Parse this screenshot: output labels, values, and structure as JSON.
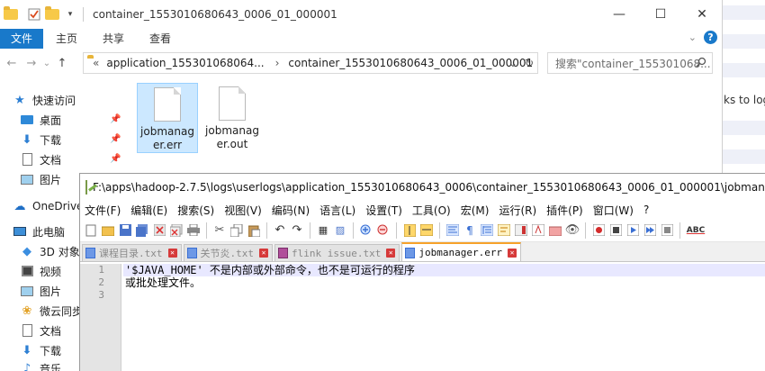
{
  "background": {
    "partial_text": "ks to log"
  },
  "explorer": {
    "title": "container_1553010680643_0006_01_000001",
    "window_buttons": {
      "minimize": "—",
      "maximize": "☐",
      "close": "✕"
    },
    "ribbon_tabs": [
      "文件",
      "主页",
      "共享",
      "查看"
    ],
    "nav": {
      "back": "←",
      "forward": "→",
      "dropdown": "⌄",
      "up": "↑"
    },
    "address": {
      "prefix": "«",
      "segment1": "application_155301068064...",
      "chevron": "›",
      "segment2": "container_1553010680643_0006_01_000001",
      "dropdown": "⌄",
      "refresh": "↻"
    },
    "search_placeholder": "搜索\"container_155301068...",
    "nav_pane": [
      {
        "label": "快速访问",
        "icon": "star-icon"
      },
      {
        "label": "桌面",
        "icon": "desktop-icon",
        "pinned": true
      },
      {
        "label": "下载",
        "icon": "download-icon",
        "pinned": true
      },
      {
        "label": "文档",
        "icon": "document-icon",
        "pinned": true
      },
      {
        "label": "图片",
        "icon": "picture-icon",
        "pinned": true
      },
      {
        "label": "OneDrive",
        "icon": "cloud-icon"
      },
      {
        "label": "此电脑",
        "icon": "computer-icon"
      },
      {
        "label": "3D 对象",
        "icon": "cube-icon"
      },
      {
        "label": "视频",
        "icon": "video-icon"
      },
      {
        "label": "图片",
        "icon": "picture-icon"
      },
      {
        "label": "微云同步",
        "icon": "cloud-sync-icon"
      },
      {
        "label": "文档",
        "icon": "document-icon"
      },
      {
        "label": "下载",
        "icon": "download-icon"
      },
      {
        "label": "音乐",
        "icon": "music-icon"
      }
    ],
    "files": [
      {
        "line1": "jobmanag",
        "line2": "er.err",
        "selected": true
      },
      {
        "line1": "jobmanag",
        "line2": "er.out",
        "selected": false
      }
    ]
  },
  "notepad": {
    "title": "F:\\apps\\hadoop-2.7.5\\logs\\userlogs\\application_1553010680643_0006\\container_1553010680643_0006_01_000001\\jobmanager.err - Notepad++",
    "menu": [
      "文件(F)",
      "编辑(E)",
      "搜索(S)",
      "视图(V)",
      "编码(N)",
      "语言(L)",
      "设置(T)",
      "工具(O)",
      "宏(M)",
      "运行(R)",
      "插件(P)",
      "窗口(W)",
      "?"
    ],
    "tabs": [
      {
        "label": "课程目录.txt",
        "active": false
      },
      {
        "label": "关节炎.txt",
        "active": false
      },
      {
        "label": "flink issue.txt",
        "active": false
      },
      {
        "label": "jobmanager.err",
        "active": true
      }
    ],
    "lines": [
      {
        "num": "1",
        "text": "'$JAVA_HOME' 不是内部或外部命令，也不是可运行的程序"
      },
      {
        "num": "2",
        "text": "或批处理文件。"
      },
      {
        "num": "3",
        "text": ""
      }
    ]
  }
}
